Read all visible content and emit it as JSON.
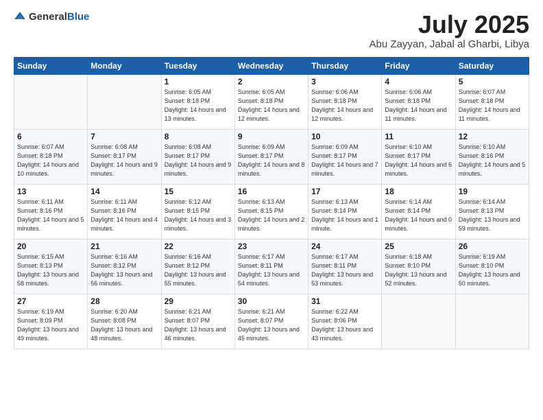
{
  "header": {
    "logo_general": "General",
    "logo_blue": "Blue",
    "title": "July 2025",
    "location": "Abu Zayyan, Jabal al Gharbi, Libya"
  },
  "weekdays": [
    "Sunday",
    "Monday",
    "Tuesday",
    "Wednesday",
    "Thursday",
    "Friday",
    "Saturday"
  ],
  "weeks": [
    [
      {
        "day": "",
        "detail": ""
      },
      {
        "day": "",
        "detail": ""
      },
      {
        "day": "1",
        "detail": "Sunrise: 6:05 AM\nSunset: 8:18 PM\nDaylight: 14 hours and 13 minutes."
      },
      {
        "day": "2",
        "detail": "Sunrise: 6:05 AM\nSunset: 8:18 PM\nDaylight: 14 hours and 12 minutes."
      },
      {
        "day": "3",
        "detail": "Sunrise: 6:06 AM\nSunset: 8:18 PM\nDaylight: 14 hours and 12 minutes."
      },
      {
        "day": "4",
        "detail": "Sunrise: 6:06 AM\nSunset: 8:18 PM\nDaylight: 14 hours and 11 minutes."
      },
      {
        "day": "5",
        "detail": "Sunrise: 6:07 AM\nSunset: 8:18 PM\nDaylight: 14 hours and 11 minutes."
      }
    ],
    [
      {
        "day": "6",
        "detail": "Sunrise: 6:07 AM\nSunset: 8:18 PM\nDaylight: 14 hours and 10 minutes."
      },
      {
        "day": "7",
        "detail": "Sunrise: 6:08 AM\nSunset: 8:17 PM\nDaylight: 14 hours and 9 minutes."
      },
      {
        "day": "8",
        "detail": "Sunrise: 6:08 AM\nSunset: 8:17 PM\nDaylight: 14 hours and 9 minutes."
      },
      {
        "day": "9",
        "detail": "Sunrise: 6:09 AM\nSunset: 8:17 PM\nDaylight: 14 hours and 8 minutes."
      },
      {
        "day": "10",
        "detail": "Sunrise: 6:09 AM\nSunset: 8:17 PM\nDaylight: 14 hours and 7 minutes."
      },
      {
        "day": "11",
        "detail": "Sunrise: 6:10 AM\nSunset: 8:17 PM\nDaylight: 14 hours and 6 minutes."
      },
      {
        "day": "12",
        "detail": "Sunrise: 6:10 AM\nSunset: 8:16 PM\nDaylight: 14 hours and 5 minutes."
      }
    ],
    [
      {
        "day": "13",
        "detail": "Sunrise: 6:11 AM\nSunset: 8:16 PM\nDaylight: 14 hours and 5 minutes."
      },
      {
        "day": "14",
        "detail": "Sunrise: 6:11 AM\nSunset: 8:16 PM\nDaylight: 14 hours and 4 minutes."
      },
      {
        "day": "15",
        "detail": "Sunrise: 6:12 AM\nSunset: 8:15 PM\nDaylight: 14 hours and 3 minutes."
      },
      {
        "day": "16",
        "detail": "Sunrise: 6:13 AM\nSunset: 8:15 PM\nDaylight: 14 hours and 2 minutes."
      },
      {
        "day": "17",
        "detail": "Sunrise: 6:13 AM\nSunset: 8:14 PM\nDaylight: 14 hours and 1 minute."
      },
      {
        "day": "18",
        "detail": "Sunrise: 6:14 AM\nSunset: 8:14 PM\nDaylight: 14 hours and 0 minutes."
      },
      {
        "day": "19",
        "detail": "Sunrise: 6:14 AM\nSunset: 8:13 PM\nDaylight: 13 hours and 59 minutes."
      }
    ],
    [
      {
        "day": "20",
        "detail": "Sunrise: 6:15 AM\nSunset: 8:13 PM\nDaylight: 13 hours and 58 minutes."
      },
      {
        "day": "21",
        "detail": "Sunrise: 6:16 AM\nSunset: 8:12 PM\nDaylight: 13 hours and 56 minutes."
      },
      {
        "day": "22",
        "detail": "Sunrise: 6:16 AM\nSunset: 8:12 PM\nDaylight: 13 hours and 55 minutes."
      },
      {
        "day": "23",
        "detail": "Sunrise: 6:17 AM\nSunset: 8:11 PM\nDaylight: 13 hours and 54 minutes."
      },
      {
        "day": "24",
        "detail": "Sunrise: 6:17 AM\nSunset: 8:11 PM\nDaylight: 13 hours and 53 minutes."
      },
      {
        "day": "25",
        "detail": "Sunrise: 6:18 AM\nSunset: 8:10 PM\nDaylight: 13 hours and 52 minutes."
      },
      {
        "day": "26",
        "detail": "Sunrise: 6:19 AM\nSunset: 8:10 PM\nDaylight: 13 hours and 50 minutes."
      }
    ],
    [
      {
        "day": "27",
        "detail": "Sunrise: 6:19 AM\nSunset: 8:09 PM\nDaylight: 13 hours and 49 minutes."
      },
      {
        "day": "28",
        "detail": "Sunrise: 6:20 AM\nSunset: 8:08 PM\nDaylight: 13 hours and 48 minutes."
      },
      {
        "day": "29",
        "detail": "Sunrise: 6:21 AM\nSunset: 8:07 PM\nDaylight: 13 hours and 46 minutes."
      },
      {
        "day": "30",
        "detail": "Sunrise: 6:21 AM\nSunset: 8:07 PM\nDaylight: 13 hours and 45 minutes."
      },
      {
        "day": "31",
        "detail": "Sunrise: 6:22 AM\nSunset: 8:06 PM\nDaylight: 13 hours and 43 minutes."
      },
      {
        "day": "",
        "detail": ""
      },
      {
        "day": "",
        "detail": ""
      }
    ]
  ]
}
